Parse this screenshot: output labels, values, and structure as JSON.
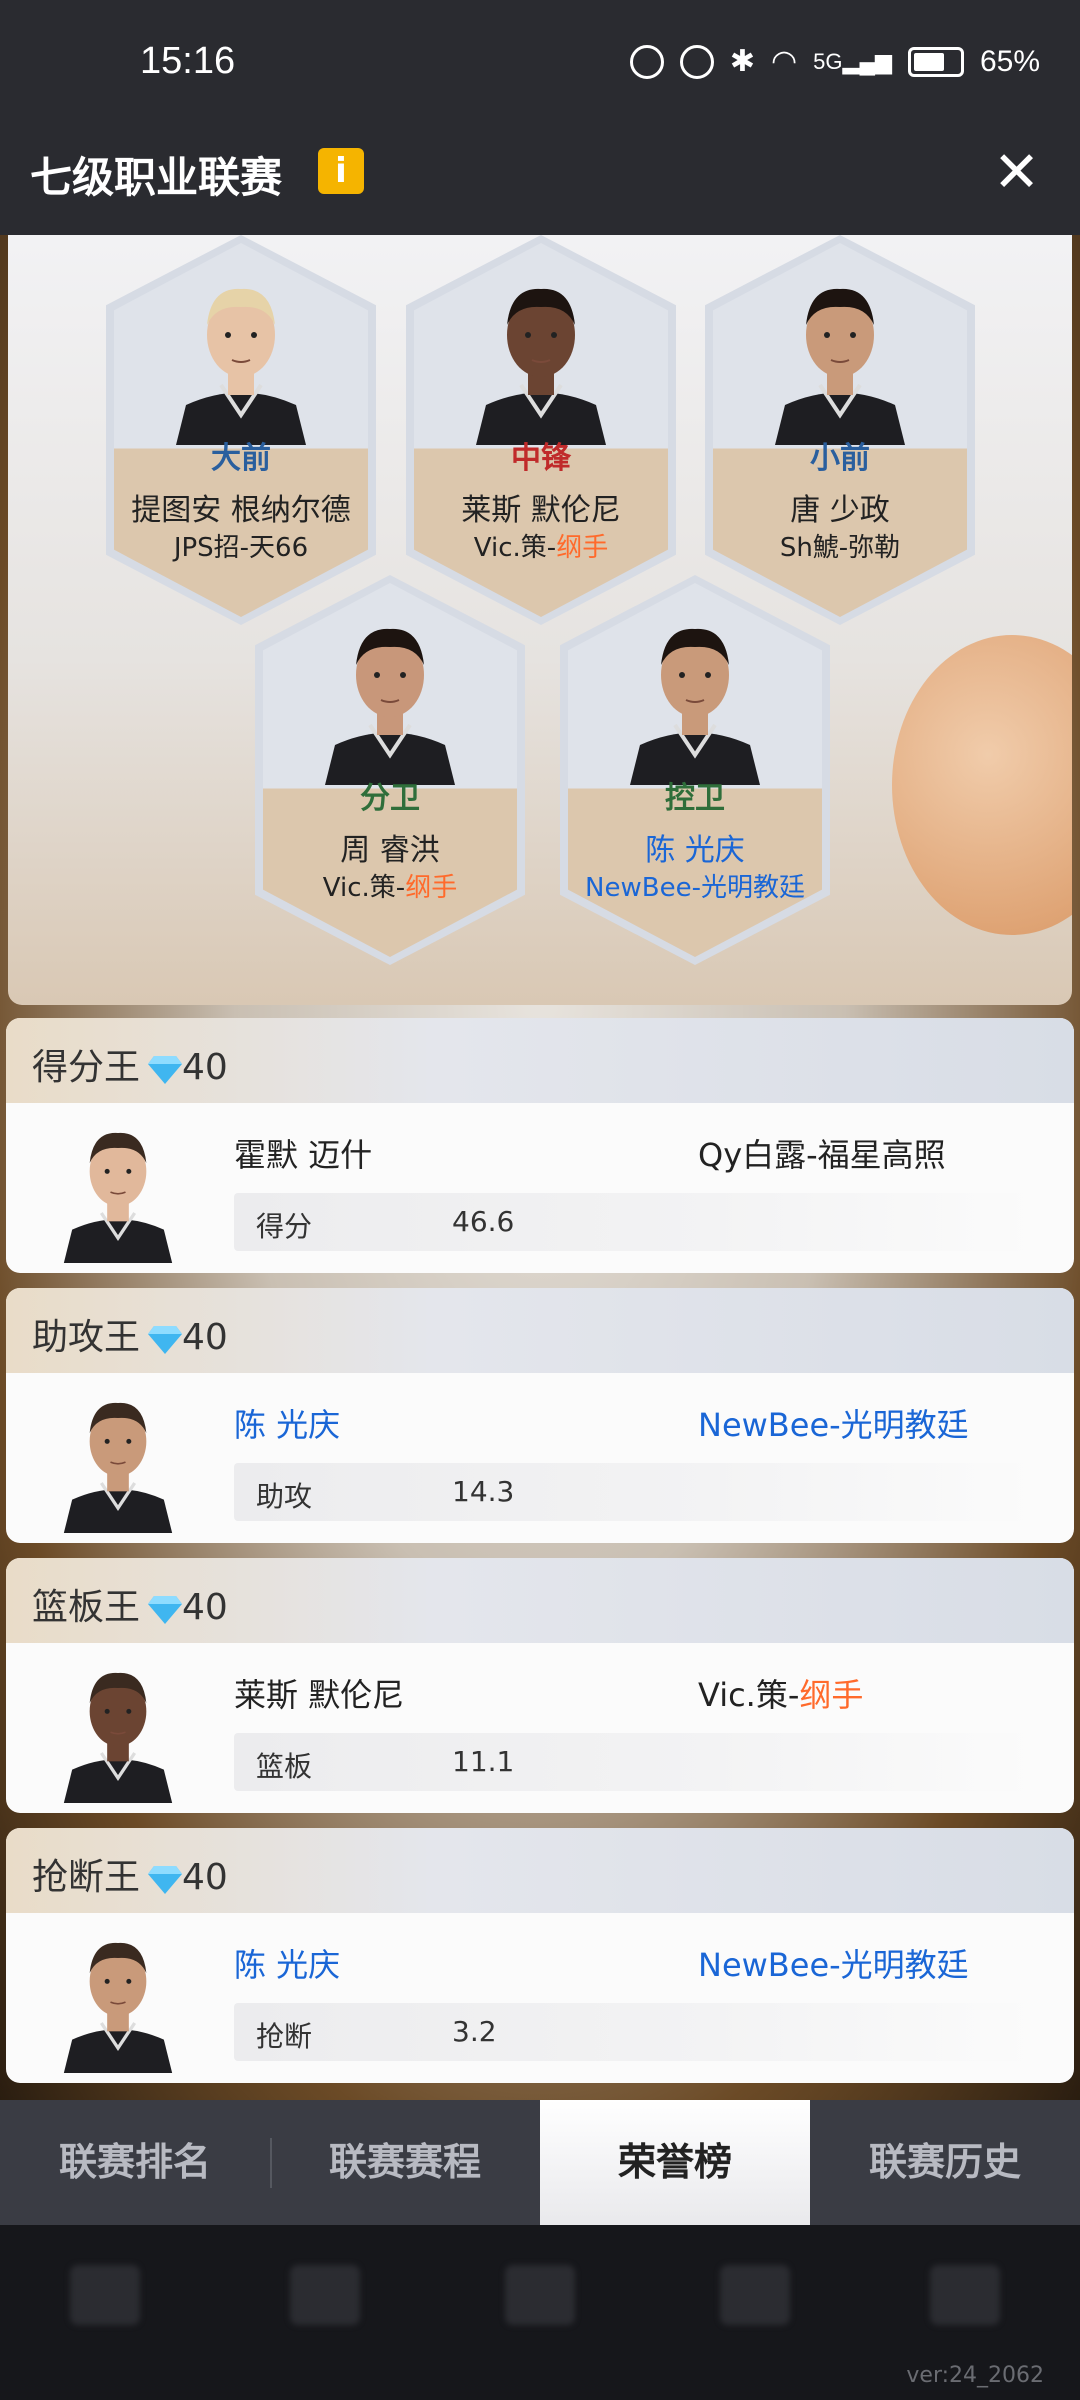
{
  "status_bar": {
    "time": "15:16",
    "battery": "65%",
    "network": "5G"
  },
  "header": {
    "title": "七级职业联赛",
    "info_icon": "info-icon",
    "close_icon": "close-icon"
  },
  "lineup": [
    {
      "position": "大前",
      "position_color": "blue",
      "name": "提图安 根纳尔德",
      "team_prefix": "JPS招-天66",
      "team_suffix": "",
      "name_color": "default"
    },
    {
      "position": "中锋",
      "position_color": "red",
      "name": "莱斯 默伦尼",
      "team_prefix": "Vic.策-",
      "team_suffix": "纲手",
      "name_color": "default"
    },
    {
      "position": "小前",
      "position_color": "blue",
      "name": "唐 少政",
      "team_prefix": "Sh鯱-弥勒",
      "team_suffix": "",
      "name_color": "default"
    },
    {
      "position": "分卫",
      "position_color": "green",
      "name": "周 睿洪",
      "team_prefix": "Vic.策-",
      "team_suffix": "纲手",
      "name_color": "default"
    },
    {
      "position": "控卫",
      "position_color": "green",
      "name": "陈 光庆",
      "team_prefix": "NewBee-光明教廷",
      "team_suffix": "",
      "name_color": "blue"
    }
  ],
  "awards": [
    {
      "title": "得分王",
      "reward": "40",
      "name": "霍默 迈什",
      "team_prefix": "Qy白露-福星高照",
      "team_suffix": "",
      "stat_label": "得分",
      "stat_value": "46.6",
      "highlight": false
    },
    {
      "title": "助攻王",
      "reward": "40",
      "name": "陈 光庆",
      "team_prefix": "NewBee-光明教廷",
      "team_suffix": "",
      "stat_label": "助攻",
      "stat_value": "14.3",
      "highlight": true
    },
    {
      "title": "篮板王",
      "reward": "40",
      "name": "莱斯 默伦尼",
      "team_prefix": "Vic.策-",
      "team_suffix": "纲手",
      "stat_label": "篮板",
      "stat_value": "11.1",
      "highlight": false
    },
    {
      "title": "抢断王",
      "reward": "40",
      "name": "陈 光庆",
      "team_prefix": "NewBee-光明教廷",
      "team_suffix": "",
      "stat_label": "抢断",
      "stat_value": "3.2",
      "highlight": true
    }
  ],
  "tabs": [
    {
      "label": "联赛排名",
      "active": false
    },
    {
      "label": "联赛赛程",
      "active": false
    },
    {
      "label": "荣誉榜",
      "active": true
    },
    {
      "label": "联赛历史",
      "active": false
    }
  ],
  "version": "ver:24_2062",
  "colors": {
    "accent_blue": "#1a66d6",
    "accent_orange": "#ff6a2b",
    "info_yellow": "#f5b400"
  }
}
